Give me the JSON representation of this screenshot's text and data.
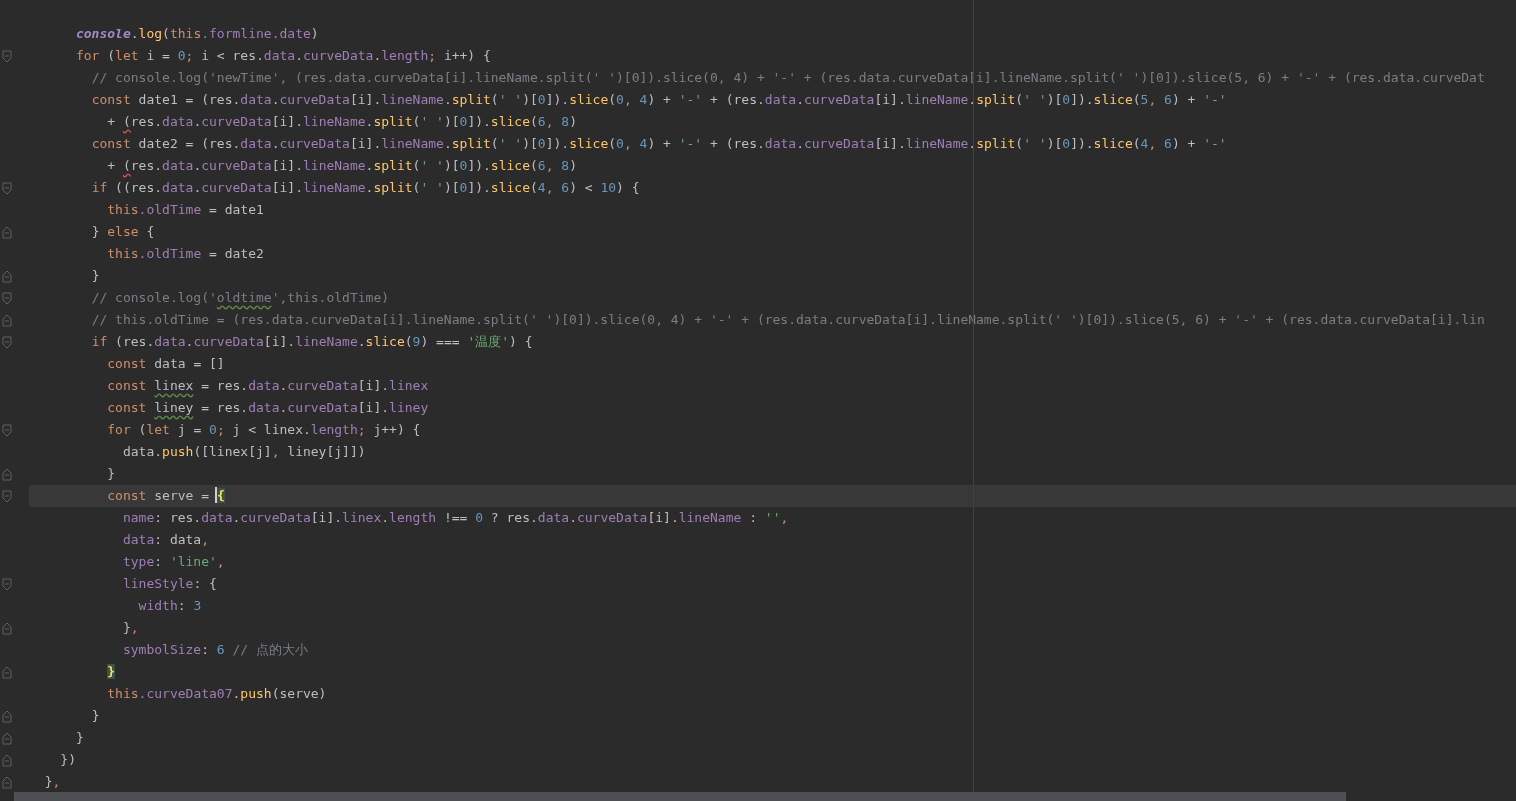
{
  "editor": {
    "lines": [
      {
        "fold_start": false,
        "fold_end": false,
        "current": false,
        "tokens": [
          {
            "kind": "g",
            "text": "      console"
          },
          {
            "kind": "p",
            "text": "."
          },
          {
            "kind": "f",
            "text": "log"
          },
          {
            "kind": "p",
            "text": "("
          },
          {
            "kind": "k",
            "text": "this"
          },
          {
            "kind": "v",
            "text": ".formline.date"
          },
          {
            "kind": "p",
            "text": ")"
          }
        ]
      },
      {
        "fold_start": true,
        "fold_end": false,
        "current": false,
        "tokens": [
          {
            "kind": "k",
            "text": "      for"
          },
          {
            "kind": "p",
            "text": " ("
          },
          {
            "kind": "k",
            "text": "let"
          },
          {
            "kind": "p",
            "text": " i = "
          },
          {
            "kind": "n",
            "text": "0"
          },
          {
            "kind": "k",
            "text": ";"
          },
          {
            "kind": "p",
            "text": " i < res."
          },
          {
            "kind": "v",
            "text": "data"
          },
          {
            "kind": "p",
            "text": "."
          },
          {
            "kind": "v",
            "text": "curveData"
          },
          {
            "kind": "p",
            "text": "."
          },
          {
            "kind": "v",
            "text": "length"
          },
          {
            "kind": "k",
            "text": ";"
          },
          {
            "kind": "p",
            "text": " i++) {"
          }
        ]
      },
      {
        "fold_start": false,
        "fold_end": false,
        "current": false,
        "tokens": [
          {
            "kind": "c",
            "text": "        // console.log('newTime', (res.data.curveData[i].lineName.split(' ')[0]).slice(0, 4) + '-' + (res.data.curveData[i].lineName.split(' ')[0]).slice(5, 6) + '-' + (res.data.curveDat"
          }
        ]
      },
      {
        "fold_start": false,
        "fold_end": false,
        "current": false,
        "tokens": [
          {
            "kind": "k",
            "text": "        const"
          },
          {
            "kind": "p",
            "text": " date1 = (res."
          },
          {
            "kind": "v",
            "text": "data"
          },
          {
            "kind": "p",
            "text": "."
          },
          {
            "kind": "v",
            "text": "curveData"
          },
          {
            "kind": "p",
            "text": "[i]."
          },
          {
            "kind": "v",
            "text": "lineName"
          },
          {
            "kind": "p",
            "text": "."
          },
          {
            "kind": "f",
            "text": "split"
          },
          {
            "kind": "p",
            "text": "("
          },
          {
            "kind": "s",
            "text": "' '"
          },
          {
            "kind": "p",
            "text": ")["
          },
          {
            "kind": "n",
            "text": "0"
          },
          {
            "kind": "p",
            "text": "])."
          },
          {
            "kind": "f",
            "text": "slice"
          },
          {
            "kind": "p",
            "text": "("
          },
          {
            "kind": "n",
            "text": "0"
          },
          {
            "kind": "k",
            "text": ","
          },
          {
            "kind": "n",
            "text": " 4"
          },
          {
            "kind": "p",
            "text": ") + "
          },
          {
            "kind": "s",
            "text": "'-'"
          },
          {
            "kind": "p",
            "text": " + (res."
          },
          {
            "kind": "v",
            "text": "data"
          },
          {
            "kind": "p",
            "text": "."
          },
          {
            "kind": "v",
            "text": "curveData"
          },
          {
            "kind": "p",
            "text": "[i]."
          },
          {
            "kind": "v",
            "text": "lineName"
          },
          {
            "kind": "p",
            "text": "."
          },
          {
            "kind": "f",
            "text": "split"
          },
          {
            "kind": "p",
            "text": "("
          },
          {
            "kind": "s",
            "text": "' '"
          },
          {
            "kind": "p",
            "text": ")["
          },
          {
            "kind": "n",
            "text": "0"
          },
          {
            "kind": "p",
            "text": "])."
          },
          {
            "kind": "f",
            "text": "slice"
          },
          {
            "kind": "p",
            "text": "("
          },
          {
            "kind": "n",
            "text": "5"
          },
          {
            "kind": "k",
            "text": ","
          },
          {
            "kind": "n",
            "text": " 6"
          },
          {
            "kind": "p",
            "text": ") + "
          },
          {
            "kind": "s",
            "text": "'-'"
          }
        ]
      },
      {
        "fold_start": false,
        "fold_end": false,
        "current": false,
        "tokens": [
          {
            "kind": "p",
            "text": "          + "
          },
          {
            "kind": "err",
            "text": "("
          },
          {
            "kind": "p",
            "text": "res."
          },
          {
            "kind": "v",
            "text": "data"
          },
          {
            "kind": "p",
            "text": "."
          },
          {
            "kind": "v",
            "text": "curveData"
          },
          {
            "kind": "p",
            "text": "[i]."
          },
          {
            "kind": "v",
            "text": "lineName"
          },
          {
            "kind": "p",
            "text": "."
          },
          {
            "kind": "f",
            "text": "split"
          },
          {
            "kind": "p",
            "text": "("
          },
          {
            "kind": "s",
            "text": "' '"
          },
          {
            "kind": "p",
            "text": ")["
          },
          {
            "kind": "n",
            "text": "0"
          },
          {
            "kind": "p",
            "text": "])."
          },
          {
            "kind": "f",
            "text": "slice"
          },
          {
            "kind": "p",
            "text": "("
          },
          {
            "kind": "n",
            "text": "6"
          },
          {
            "kind": "k",
            "text": ","
          },
          {
            "kind": "n",
            "text": " 8"
          },
          {
            "kind": "p",
            "text": ")"
          }
        ]
      },
      {
        "fold_start": false,
        "fold_end": false,
        "current": false,
        "tokens": [
          {
            "kind": "k",
            "text": "        const"
          },
          {
            "kind": "p",
            "text": " date2 = (res."
          },
          {
            "kind": "v",
            "text": "data"
          },
          {
            "kind": "p",
            "text": "."
          },
          {
            "kind": "v",
            "text": "curveData"
          },
          {
            "kind": "p",
            "text": "[i]."
          },
          {
            "kind": "v",
            "text": "lineName"
          },
          {
            "kind": "p",
            "text": "."
          },
          {
            "kind": "f",
            "text": "split"
          },
          {
            "kind": "p",
            "text": "("
          },
          {
            "kind": "s",
            "text": "' '"
          },
          {
            "kind": "p",
            "text": ")["
          },
          {
            "kind": "n",
            "text": "0"
          },
          {
            "kind": "p",
            "text": "])."
          },
          {
            "kind": "f",
            "text": "slice"
          },
          {
            "kind": "p",
            "text": "("
          },
          {
            "kind": "n",
            "text": "0"
          },
          {
            "kind": "k",
            "text": ","
          },
          {
            "kind": "n",
            "text": " 4"
          },
          {
            "kind": "p",
            "text": ") + "
          },
          {
            "kind": "s",
            "text": "'-'"
          },
          {
            "kind": "p",
            "text": " + (res."
          },
          {
            "kind": "v",
            "text": "data"
          },
          {
            "kind": "p",
            "text": "."
          },
          {
            "kind": "v",
            "text": "curveData"
          },
          {
            "kind": "p",
            "text": "[i]."
          },
          {
            "kind": "v",
            "text": "lineName"
          },
          {
            "kind": "p",
            "text": "."
          },
          {
            "kind": "f",
            "text": "split"
          },
          {
            "kind": "p",
            "text": "("
          },
          {
            "kind": "s",
            "text": "' '"
          },
          {
            "kind": "p",
            "text": ")["
          },
          {
            "kind": "n",
            "text": "0"
          },
          {
            "kind": "p",
            "text": "])."
          },
          {
            "kind": "f",
            "text": "slice"
          },
          {
            "kind": "p",
            "text": "("
          },
          {
            "kind": "n",
            "text": "4"
          },
          {
            "kind": "k",
            "text": ","
          },
          {
            "kind": "n",
            "text": " 6"
          },
          {
            "kind": "p",
            "text": ") + "
          },
          {
            "kind": "s",
            "text": "'-'"
          }
        ]
      },
      {
        "fold_start": false,
        "fold_end": false,
        "current": false,
        "tokens": [
          {
            "kind": "p",
            "text": "          + "
          },
          {
            "kind": "err",
            "text": "("
          },
          {
            "kind": "p",
            "text": "res."
          },
          {
            "kind": "v",
            "text": "data"
          },
          {
            "kind": "p",
            "text": "."
          },
          {
            "kind": "v",
            "text": "curveData"
          },
          {
            "kind": "p",
            "text": "[i]."
          },
          {
            "kind": "v",
            "text": "lineName"
          },
          {
            "kind": "p",
            "text": "."
          },
          {
            "kind": "f",
            "text": "split"
          },
          {
            "kind": "p",
            "text": "("
          },
          {
            "kind": "s",
            "text": "' '"
          },
          {
            "kind": "p",
            "text": ")["
          },
          {
            "kind": "n",
            "text": "0"
          },
          {
            "kind": "p",
            "text": "])."
          },
          {
            "kind": "f",
            "text": "slice"
          },
          {
            "kind": "p",
            "text": "("
          },
          {
            "kind": "n",
            "text": "6"
          },
          {
            "kind": "k",
            "text": ","
          },
          {
            "kind": "n",
            "text": " 8"
          },
          {
            "kind": "p",
            "text": ")"
          }
        ]
      },
      {
        "fold_start": true,
        "fold_end": false,
        "current": false,
        "tokens": [
          {
            "kind": "k",
            "text": "        if"
          },
          {
            "kind": "p",
            "text": " ((res."
          },
          {
            "kind": "v",
            "text": "data"
          },
          {
            "kind": "p",
            "text": "."
          },
          {
            "kind": "v",
            "text": "curveData"
          },
          {
            "kind": "p",
            "text": "[i]."
          },
          {
            "kind": "v",
            "text": "lineName"
          },
          {
            "kind": "p",
            "text": "."
          },
          {
            "kind": "f",
            "text": "split"
          },
          {
            "kind": "p",
            "text": "("
          },
          {
            "kind": "s",
            "text": "' '"
          },
          {
            "kind": "p",
            "text": ")["
          },
          {
            "kind": "n",
            "text": "0"
          },
          {
            "kind": "p",
            "text": "])."
          },
          {
            "kind": "f",
            "text": "slice"
          },
          {
            "kind": "p",
            "text": "("
          },
          {
            "kind": "n",
            "text": "4"
          },
          {
            "kind": "k",
            "text": ","
          },
          {
            "kind": "n",
            "text": " 6"
          },
          {
            "kind": "p",
            "text": ") < "
          },
          {
            "kind": "n",
            "text": "10"
          },
          {
            "kind": "p",
            "text": ") {"
          }
        ]
      },
      {
        "fold_start": false,
        "fold_end": false,
        "current": false,
        "tokens": [
          {
            "kind": "k",
            "text": "          this"
          },
          {
            "kind": "v",
            "text": ".oldTime"
          },
          {
            "kind": "p",
            "text": " = date1"
          }
        ]
      },
      {
        "fold_start": false,
        "fold_end": true,
        "current": false,
        "tokens": [
          {
            "kind": "p",
            "text": "        } "
          },
          {
            "kind": "k",
            "text": "else"
          },
          {
            "kind": "p",
            "text": " {"
          }
        ]
      },
      {
        "fold_start": false,
        "fold_end": false,
        "current": false,
        "tokens": [
          {
            "kind": "k",
            "text": "          this"
          },
          {
            "kind": "v",
            "text": ".oldTime"
          },
          {
            "kind": "p",
            "text": " = date2"
          }
        ]
      },
      {
        "fold_start": false,
        "fold_end": true,
        "current": false,
        "tokens": [
          {
            "kind": "p",
            "text": "        }"
          }
        ]
      },
      {
        "fold_start": true,
        "fold_end": false,
        "current": false,
        "tokens": [
          {
            "kind": "c",
            "text": "        // console.log('"
          },
          {
            "kind": "cwarn",
            "text": "oldtime"
          },
          {
            "kind": "c",
            "text": "',this.oldTime)"
          }
        ]
      },
      {
        "fold_start": false,
        "fold_end": true,
        "current": false,
        "tokens": [
          {
            "kind": "c",
            "text": "        // this.oldTime = (res.data.curveData[i].lineName.split(' ')[0]).slice(0, 4) + '-' + (res.data.curveData[i].lineName.split(' ')[0]).slice(5, 6) + '-' + (res.data.curveData[i].lin"
          }
        ]
      },
      {
        "fold_start": true,
        "fold_end": false,
        "current": false,
        "tokens": [
          {
            "kind": "k",
            "text": "        if"
          },
          {
            "kind": "p",
            "text": " (res."
          },
          {
            "kind": "v",
            "text": "data"
          },
          {
            "kind": "p",
            "text": "."
          },
          {
            "kind": "v",
            "text": "curveData"
          },
          {
            "kind": "p",
            "text": "[i]."
          },
          {
            "kind": "v",
            "text": "lineName"
          },
          {
            "kind": "p",
            "text": "."
          },
          {
            "kind": "f",
            "text": "slice"
          },
          {
            "kind": "p",
            "text": "("
          },
          {
            "kind": "n",
            "text": "9"
          },
          {
            "kind": "p",
            "text": ") === "
          },
          {
            "kind": "s",
            "text": "'温度'"
          },
          {
            "kind": "p",
            "text": ") {"
          }
        ]
      },
      {
        "fold_start": false,
        "fold_end": false,
        "current": false,
        "tokens": [
          {
            "kind": "k",
            "text": "          const"
          },
          {
            "kind": "p",
            "text": " data = []"
          }
        ]
      },
      {
        "fold_start": false,
        "fold_end": false,
        "current": false,
        "tokens": [
          {
            "kind": "k",
            "text": "          const "
          },
          {
            "kind": "warn",
            "text": "linex"
          },
          {
            "kind": "p",
            "text": " = res."
          },
          {
            "kind": "v",
            "text": "data"
          },
          {
            "kind": "p",
            "text": "."
          },
          {
            "kind": "v",
            "text": "curveData"
          },
          {
            "kind": "p",
            "text": "[i]."
          },
          {
            "kind": "v",
            "text": "linex"
          }
        ]
      },
      {
        "fold_start": false,
        "fold_end": false,
        "current": false,
        "tokens": [
          {
            "kind": "k",
            "text": "          const "
          },
          {
            "kind": "warn",
            "text": "liney"
          },
          {
            "kind": "p",
            "text": " = res."
          },
          {
            "kind": "v",
            "text": "data"
          },
          {
            "kind": "p",
            "text": "."
          },
          {
            "kind": "v",
            "text": "curveData"
          },
          {
            "kind": "p",
            "text": "[i]."
          },
          {
            "kind": "v",
            "text": "liney"
          }
        ]
      },
      {
        "fold_start": true,
        "fold_end": false,
        "current": false,
        "tokens": [
          {
            "kind": "k",
            "text": "          for"
          },
          {
            "kind": "p",
            "text": " ("
          },
          {
            "kind": "k",
            "text": "let"
          },
          {
            "kind": "p",
            "text": " j = "
          },
          {
            "kind": "n",
            "text": "0"
          },
          {
            "kind": "k",
            "text": ";"
          },
          {
            "kind": "p",
            "text": " j < linex."
          },
          {
            "kind": "v",
            "text": "length"
          },
          {
            "kind": "k",
            "text": ";"
          },
          {
            "kind": "p",
            "text": " j++) {"
          }
        ]
      },
      {
        "fold_start": false,
        "fold_end": false,
        "current": false,
        "tokens": [
          {
            "kind": "p",
            "text": "            data."
          },
          {
            "kind": "f",
            "text": "push"
          },
          {
            "kind": "p",
            "text": "([linex[j]"
          },
          {
            "kind": "k",
            "text": ","
          },
          {
            "kind": "p",
            "text": " liney[j]])"
          }
        ]
      },
      {
        "fold_start": false,
        "fold_end": true,
        "current": false,
        "tokens": [
          {
            "kind": "p",
            "text": "          }"
          }
        ]
      },
      {
        "fold_start": true,
        "fold_end": false,
        "current": true,
        "tokens": [
          {
            "kind": "k",
            "text": "          const"
          },
          {
            "kind": "p",
            "text": " serve = "
          },
          {
            "kind": "b",
            "text": "{",
            "caret": true
          }
        ]
      },
      {
        "fold_start": false,
        "fold_end": false,
        "current": false,
        "tokens": [
          {
            "kind": "v",
            "text": "            name"
          },
          {
            "kind": "p",
            "text": ": res."
          },
          {
            "kind": "v",
            "text": "data"
          },
          {
            "kind": "p",
            "text": "."
          },
          {
            "kind": "v",
            "text": "curveData"
          },
          {
            "kind": "p",
            "text": "[i]."
          },
          {
            "kind": "v",
            "text": "linex"
          },
          {
            "kind": "p",
            "text": "."
          },
          {
            "kind": "v",
            "text": "length"
          },
          {
            "kind": "p",
            "text": " !== "
          },
          {
            "kind": "n",
            "text": "0"
          },
          {
            "kind": "p",
            "text": " ? res."
          },
          {
            "kind": "v",
            "text": "data"
          },
          {
            "kind": "p",
            "text": "."
          },
          {
            "kind": "v",
            "text": "curveData"
          },
          {
            "kind": "p",
            "text": "[i]."
          },
          {
            "kind": "v",
            "text": "lineName"
          },
          {
            "kind": "p",
            "text": " : "
          },
          {
            "kind": "s",
            "text": "''"
          },
          {
            "kind": "k",
            "text": ","
          }
        ]
      },
      {
        "fold_start": false,
        "fold_end": false,
        "current": false,
        "tokens": [
          {
            "kind": "v",
            "text": "            data"
          },
          {
            "kind": "p",
            "text": ": data"
          },
          {
            "kind": "k",
            "text": ","
          }
        ]
      },
      {
        "fold_start": false,
        "fold_end": false,
        "current": false,
        "tokens": [
          {
            "kind": "v",
            "text": "            type"
          },
          {
            "kind": "p",
            "text": ": "
          },
          {
            "kind": "s",
            "text": "'line'"
          },
          {
            "kind": "k",
            "text": ","
          }
        ]
      },
      {
        "fold_start": true,
        "fold_end": false,
        "current": false,
        "tokens": [
          {
            "kind": "v",
            "text": "            lineStyle"
          },
          {
            "kind": "p",
            "text": ": {"
          }
        ]
      },
      {
        "fold_start": false,
        "fold_end": false,
        "current": false,
        "tokens": [
          {
            "kind": "v",
            "text": "              width"
          },
          {
            "kind": "p",
            "text": ": "
          },
          {
            "kind": "n",
            "text": "3"
          }
        ]
      },
      {
        "fold_start": false,
        "fold_end": true,
        "current": false,
        "tokens": [
          {
            "kind": "p",
            "text": "            }"
          },
          {
            "kind": "k",
            "text": ","
          }
        ]
      },
      {
        "fold_start": false,
        "fold_end": false,
        "current": false,
        "tokens": [
          {
            "kind": "v",
            "text": "            symbolSize"
          },
          {
            "kind": "p",
            "text": ": "
          },
          {
            "kind": "n",
            "text": "6"
          },
          {
            "kind": "c",
            "text": " // 点的大小"
          }
        ]
      },
      {
        "fold_start": false,
        "fold_end": true,
        "current": false,
        "tokens": [
          {
            "kind": "b",
            "text": "          }"
          }
        ]
      },
      {
        "fold_start": false,
        "fold_end": false,
        "current": false,
        "tokens": [
          {
            "kind": "k",
            "text": "          this"
          },
          {
            "kind": "v",
            "text": ".curveData07"
          },
          {
            "kind": "p",
            "text": "."
          },
          {
            "kind": "f",
            "text": "push"
          },
          {
            "kind": "p",
            "text": "(serve)"
          }
        ]
      },
      {
        "fold_start": false,
        "fold_end": true,
        "current": false,
        "tokens": [
          {
            "kind": "p",
            "text": "        }"
          }
        ]
      },
      {
        "fold_start": false,
        "fold_end": true,
        "current": false,
        "tokens": [
          {
            "kind": "p",
            "text": "      }"
          }
        ]
      },
      {
        "fold_start": false,
        "fold_end": true,
        "current": false,
        "tokens": [
          {
            "kind": "p",
            "text": "    })"
          }
        ]
      },
      {
        "fold_start": false,
        "fold_end": true,
        "current": false,
        "tokens": [
          {
            "kind": "p",
            "text": "  }"
          },
          {
            "kind": "k",
            "text": ","
          }
        ]
      }
    ]
  }
}
